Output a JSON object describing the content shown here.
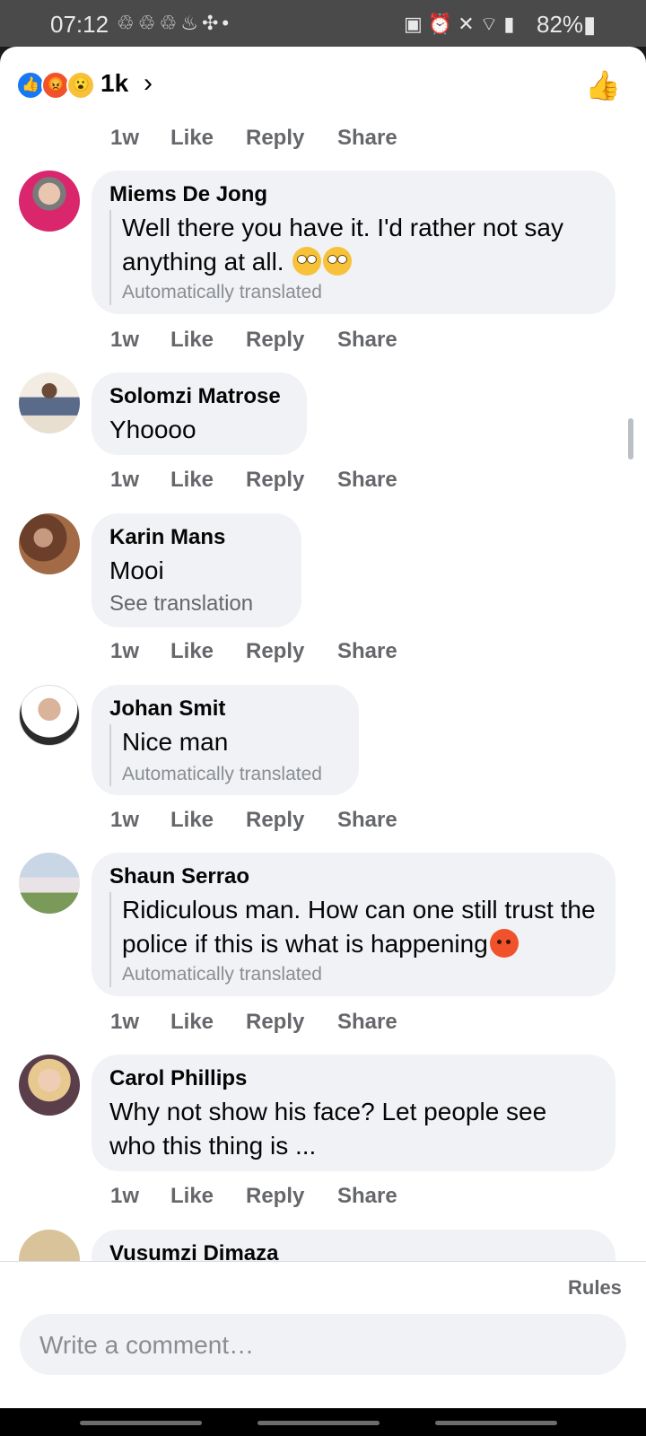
{
  "status_bar": {
    "time": "07:12",
    "battery": "82%",
    "left_icons": [
      "sync-icon",
      "sync-icon",
      "sync-icon",
      "notification-icon",
      "app-icon",
      "dot-icon"
    ],
    "right_icons": [
      "battery-saver-icon",
      "alarm-icon",
      "mute-icon",
      "wifi-icon",
      "signal-icon"
    ]
  },
  "reactions": {
    "count": "1k",
    "types": [
      "like",
      "angry",
      "wow"
    ]
  },
  "comments": [
    {
      "name": "",
      "text": "",
      "time": "1w",
      "like": "Like",
      "reply": "Reply",
      "share": "Share"
    },
    {
      "name": "Miems De Jong",
      "text": "Well there you have it. I'd rather not say anything at all.",
      "emoji": [
        "face-with-rolling-eyes",
        "face-with-rolling-eyes"
      ],
      "translated": "Automatically translated",
      "time": "1w",
      "like": "Like",
      "reply": "Reply",
      "share": "Share"
    },
    {
      "name": "Solomzi Matrose",
      "text": "Yhoooo",
      "time": "1w",
      "like": "Like",
      "reply": "Reply",
      "share": "Share"
    },
    {
      "name": "Karin Mans",
      "text": "Mooi",
      "see_translation": "See translation",
      "time": "1w",
      "like": "Like",
      "reply": "Reply",
      "share": "Share"
    },
    {
      "name": "Johan Smit",
      "text": "Nice man",
      "translated": "Automatically translated",
      "time": "1w",
      "like": "Like",
      "reply": "Reply",
      "share": "Share"
    },
    {
      "name": "Shaun Serrao",
      "text": "Ridiculous man. How can one still trust the police if this is what is happening",
      "emoji": [
        "angry-face"
      ],
      "translated": "Automatically translated",
      "time": "1w",
      "like": "Like",
      "reply": "Reply",
      "share": "Share"
    },
    {
      "name": "Carol Phillips",
      "text": "Why not show his face? Let people see who this thing is ...",
      "time": "1w",
      "like": "Like",
      "reply": "Reply",
      "share": "Share"
    },
    {
      "name": "Vusumzi Dimaza"
    }
  ],
  "footer": {
    "rules": "Rules",
    "comment_placeholder": "Write a comment…"
  },
  "colors": {
    "bubble": "#f0f2f5",
    "like_blue": "#1877f2",
    "secondary_text": "#65676b"
  }
}
